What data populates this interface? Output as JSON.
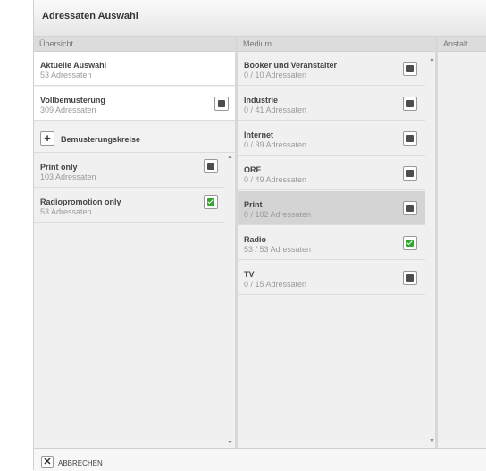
{
  "dialog": {
    "title": "Adressaten Auswahl"
  },
  "columns": {
    "overview": {
      "header": "Übersicht",
      "current": {
        "title": "Aktuelle Auswahl",
        "subtitle": "53 Adressaten"
      },
      "full": {
        "title": "Vollbemusterung",
        "subtitle": "309 Adressaten",
        "checked": false
      },
      "add_label": "Bemusterungskreise",
      "circles": [
        {
          "title": "Print only",
          "subtitle": "103 Adressaten",
          "checked": false
        },
        {
          "title": "Radiopromotion only",
          "subtitle": "53 Adressaten",
          "checked": true
        }
      ]
    },
    "medium": {
      "header": "Medium",
      "items": [
        {
          "title": "Booker und Veranstalter",
          "subtitle": "0 / 10 Adressaten",
          "checked": false,
          "selected": false
        },
        {
          "title": "Industrie",
          "subtitle": "0 / 41 Adressaten",
          "checked": false,
          "selected": false
        },
        {
          "title": "Internet",
          "subtitle": "0 / 39 Adressaten",
          "checked": false,
          "selected": false
        },
        {
          "title": "ORF",
          "subtitle": "0 / 49 Adressaten",
          "checked": false,
          "selected": false
        },
        {
          "title": "Print",
          "subtitle": "0 / 102 Adressaten",
          "checked": false,
          "selected": true
        },
        {
          "title": "Radio",
          "subtitle": "53 / 53 Adressaten",
          "checked": true,
          "selected": false
        },
        {
          "title": "TV",
          "subtitle": "0 / 15 Adressaten",
          "checked": false,
          "selected": false
        }
      ]
    },
    "institution": {
      "header": "Anstalt"
    }
  },
  "footer": {
    "cancel_label": "ABBRECHEN"
  },
  "icons": {
    "add": "plus-icon",
    "cancel": "close-icon",
    "check": "check-icon"
  },
  "colors": {
    "checked": "#2ea82e",
    "unchecked": "#4d4d4d",
    "selected_row": "#d4d4d4"
  }
}
